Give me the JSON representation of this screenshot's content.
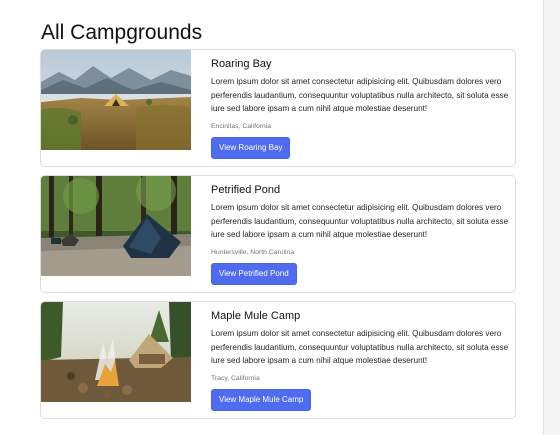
{
  "page": {
    "title": "All Campgrounds"
  },
  "campgrounds": [
    {
      "name": "Roaring Bay",
      "description": "Lorem ipsum dolor sit amet consectetur adipisicing elit. Quibusdam dolores vero perferendis laudantium, consequuntur voluptatibus nulla architecto, sit soluta esse iure sed labore ipsam a cum nihil atque molestiae deserunt!",
      "location": "Encinitas, California",
      "button_label": "View Roaring Bay",
      "image": "mountain-tent-scene"
    },
    {
      "name": "Petrified Pond",
      "description": "Lorem ipsum dolor sit amet consectetur adipisicing elit. Quibusdam dolores vero perferendis laudantium, consequuntur voluptatibus nulla architecto, sit soluta esse iure sed labore ipsam a cum nihil atque molestiae deserunt!",
      "location": "Huntersville, North Carolina",
      "button_label": "View Petrified Pond",
      "image": "forest-tent-scene"
    },
    {
      "name": "Maple Mule Camp",
      "description": "Lorem ipsum dolor sit amet consectetur adipisicing elit. Quibusdam dolores vero perferendis laudantium, consequuntur voluptatibus nulla architecto, sit soluta esse iure sed labore ipsam a cum nihil atque molestiae deserunt!",
      "location": "Tracy, California",
      "button_label": "View Maple Mule Camp",
      "image": "campfire-scene"
    }
  ],
  "colors": {
    "primary_button": "#4f6cf0",
    "muted_text": "#6c757d",
    "card_border": "#dcdcdc"
  }
}
